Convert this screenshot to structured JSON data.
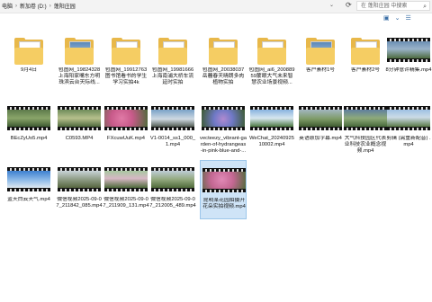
{
  "breadcrumb": {
    "items": [
      "电脑",
      "新加卷 (D:)",
      "蓬阳庄园"
    ],
    "chevron": "›"
  },
  "search": {
    "placeholder": "在 蓬阳庄园 中搜索"
  },
  "icons": {
    "refresh": "refresh-icon",
    "search": "search-icon",
    "view": "view-icons"
  },
  "items": [
    {
      "name": "9月4日",
      "kind": "folder",
      "paper": "plain"
    },
    {
      "name": "包图网_19824328上海阳家嘴东方明珠滨云台天际线...",
      "kind": "folder",
      "paper": "photo"
    },
    {
      "name": "包图网_19912763图书馆看书的学生学习实拍4k",
      "kind": "folder",
      "paper": "plain"
    },
    {
      "name": "包图网_19981666上海南浦大桥车流延时实拍",
      "kind": "folder",
      "paper": "plain"
    },
    {
      "name": "包图网_20038037岳麓春天晴朗多肉植物实拍",
      "kind": "folder",
      "paper": "plain"
    },
    {
      "name": "包图网_ai6_20088959蒙眼大气未来智慧农业场景视频...",
      "kind": "folder",
      "paper": "plain"
    },
    {
      "name": "客户素材1号",
      "kind": "folder",
      "paper": "photo"
    },
    {
      "name": "客户素材2号",
      "kind": "folder",
      "paper": "plain"
    },
    {
      "name": "8分钟意许精集.mp4",
      "kind": "video",
      "bg": "linear-gradient(180deg,#6b8fb4 0%,#9ab3c9 45%,#4d6b3f 100%)"
    },
    {
      "name": "BEcZyUo5.mp4",
      "kind": "video",
      "bg": "linear-gradient(180deg,#5d7a4b 0%,#8aa56a 50%,#3e5a32 100%)"
    },
    {
      "name": "C0593.MP4",
      "kind": "video",
      "bg": "linear-gradient(180deg,#6e8b5a 0%,#b7c08c 50%,#4f6b3e 100%)"
    },
    {
      "name": "FXcuwUuK.mp4",
      "kind": "video",
      "bg": "radial-gradient(circle at 40% 50%,#e07aa6 0%,#c85a8a 40%,#4f6b3a 100%)"
    },
    {
      "name": "V1-0014_ss1_000_1.mp4",
      "kind": "video",
      "bg": "linear-gradient(180deg,#7aa2c8 0%,#cfd9e2 55%,#555f56 100%)"
    },
    {
      "name": "vecteezy_vibrant-garden-of-hydrangeas-in-pink-blue-and-...",
      "kind": "video",
      "bg": "radial-gradient(circle at 50% 55%,#b08ad0 0%,#6f79c6 40%,#3b5a2e 100%)"
    },
    {
      "name": "WeChat_2024092510002.mp4",
      "kind": "video",
      "bg": "linear-gradient(180deg,#88b3df 0%,#d7e6ef 50%,#4e7a44 100%)"
    },
    {
      "name": "英语原加字幕.mp4",
      "kind": "video",
      "bg": "linear-gradient(180deg,#a2b6c0 0%,#7d9a66 55%,#3f5b30 100%)"
    },
    {
      "name": "大气科技园区代表业科技农业概念视频.mp4",
      "kind": "video",
      "bg": "linear-gradient(180deg,#5f7f9f 0%,#8eaa7a 50%,#47693a 100%)"
    },
    {
      "name": "剪辑 (需重新配音) .mp4",
      "kind": "video",
      "bg": "linear-gradient(180deg,#9ec1e3 0%,#ccdbe6 45%,#5a7a48 100%)"
    },
    {
      "name": "蓝天白云天气.mp4",
      "kind": "video",
      "bg": "linear-gradient(180deg,#3d7fd0 0%,#8fbbe8 55%,#dfe9f0 100%)"
    },
    {
      "name": "微信视频2025-09-07_211842_085.mp4",
      "kind": "video",
      "bg": "linear-gradient(180deg,#c9d4d9 0%,#8f9d86 50%,#56653f 100%)"
    },
    {
      "name": "微信视频2025-09-07_211909_131.mp4",
      "kind": "video",
      "bg": "linear-gradient(180deg,#a7c8a0 0%,#d7b8c5 45%,#4f6a3b 100%)"
    },
    {
      "name": "微信视频2025-09-07_212005_489.mp4",
      "kind": "video",
      "bg": "linear-gradient(180deg,#bfcdd8 0%,#93a97f 50%,#4f6a3a 100%)"
    },
    {
      "name": "昆明某花园拍摄开花朵实拍视频.mp4",
      "kind": "video",
      "selected": true,
      "bg": "radial-gradient(circle at 45% 45%,#e089b6 0%,#c36792 45%,#506b3b 100%)"
    }
  ]
}
